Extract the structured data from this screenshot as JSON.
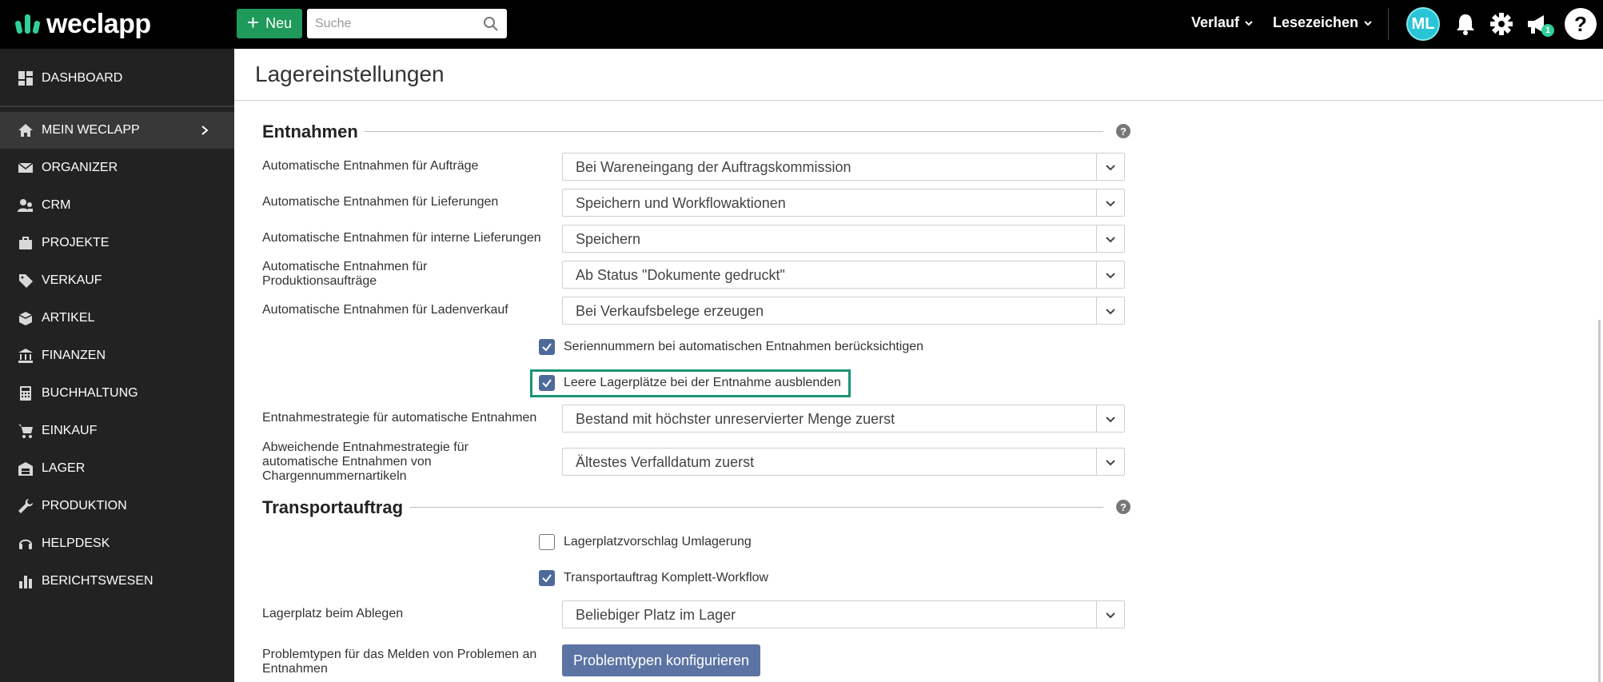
{
  "app": {
    "logo_text": "weclapp"
  },
  "topbar": {
    "new_label": "Neu",
    "search_placeholder": "Suche",
    "history_label": "Verlauf",
    "bookmarks_label": "Lesezeichen",
    "avatar_initials": "ML",
    "notification_badge": "1",
    "help_label": "?"
  },
  "sidebar": {
    "items": [
      {
        "label": "DASHBOARD",
        "icon": "dashboard-icon"
      },
      {
        "label": "MEIN WECLAPP",
        "icon": "home-icon"
      },
      {
        "label": "ORGANIZER",
        "icon": "mail-icon"
      },
      {
        "label": "CRM",
        "icon": "contacts-icon"
      },
      {
        "label": "PROJEKTE",
        "icon": "briefcase-icon"
      },
      {
        "label": "VERKAUF",
        "icon": "tag-icon"
      },
      {
        "label": "ARTIKEL",
        "icon": "box-icon"
      },
      {
        "label": "FINANZEN",
        "icon": "bank-icon"
      },
      {
        "label": "BUCHHALTUNG",
        "icon": "calculator-icon"
      },
      {
        "label": "EINKAUF",
        "icon": "cart-icon"
      },
      {
        "label": "LAGER",
        "icon": "warehouse-icon"
      },
      {
        "label": "PRODUKTION",
        "icon": "wrench-icon"
      },
      {
        "label": "HELPDESK",
        "icon": "headset-icon"
      },
      {
        "label": "BERICHTSWESEN",
        "icon": "bar-chart-icon"
      }
    ]
  },
  "page": {
    "title": "Lagereinstellungen"
  },
  "sections": {
    "entnahmen": {
      "title": "Entnahmen",
      "fields": [
        {
          "label": "Automatische Entnahmen für Aufträge",
          "value": "Bei Wareneingang der Auftragskommission"
        },
        {
          "label": "Automatische Entnahmen für Lieferungen",
          "value": "Speichern und Workflowaktionen"
        },
        {
          "label": "Automatische Entnahmen für interne Lieferungen",
          "value": "Speichern"
        },
        {
          "label": "Automatische Entnahmen für Produktionsaufträge",
          "value": "Ab Status \"Dokumente gedruckt\""
        },
        {
          "label": "Automatische Entnahmen für Ladenverkauf",
          "value": "Bei Verkaufsbelege erzeugen"
        }
      ],
      "checkboxes": [
        {
          "label": "Seriennummern bei automatischen Entnahmen berücksichtigen",
          "checked": true
        },
        {
          "label": "Leere Lagerplätze bei der Entnahme ausblenden",
          "checked": true
        }
      ],
      "strategy": {
        "label": "Entnahmestrategie für automatische Entnahmen",
        "value": "Bestand mit höchster unreservierter Menge zuerst"
      },
      "alt_strategy": {
        "label": "Abweichende Entnahmestrategie für automatische Entnahmen von Chargennummernartikeln",
        "value": "Ältestes Verfalldatum zuerst"
      }
    },
    "transport": {
      "title": "Transportauftrag",
      "checkboxes": [
        {
          "label": "Lagerplatzvorschlag Umlagerung",
          "checked": false
        },
        {
          "label": "Transportauftrag Komplett-Workflow",
          "checked": true
        }
      ],
      "drop_location": {
        "label": "Lagerplatz beim Ablegen",
        "value": "Beliebiger Platz im Lager"
      },
      "problem_types": {
        "label": "Problemtypen für das Melden von Problemen an Entnahmen",
        "button": "Problemtypen konfigurieren"
      }
    }
  },
  "colors": {
    "accent": "#1f9a5b",
    "logo": "#2fd19a",
    "checkbox": "#4e6a9a",
    "highlight": "#1a9474",
    "button": "#5b74a3"
  }
}
